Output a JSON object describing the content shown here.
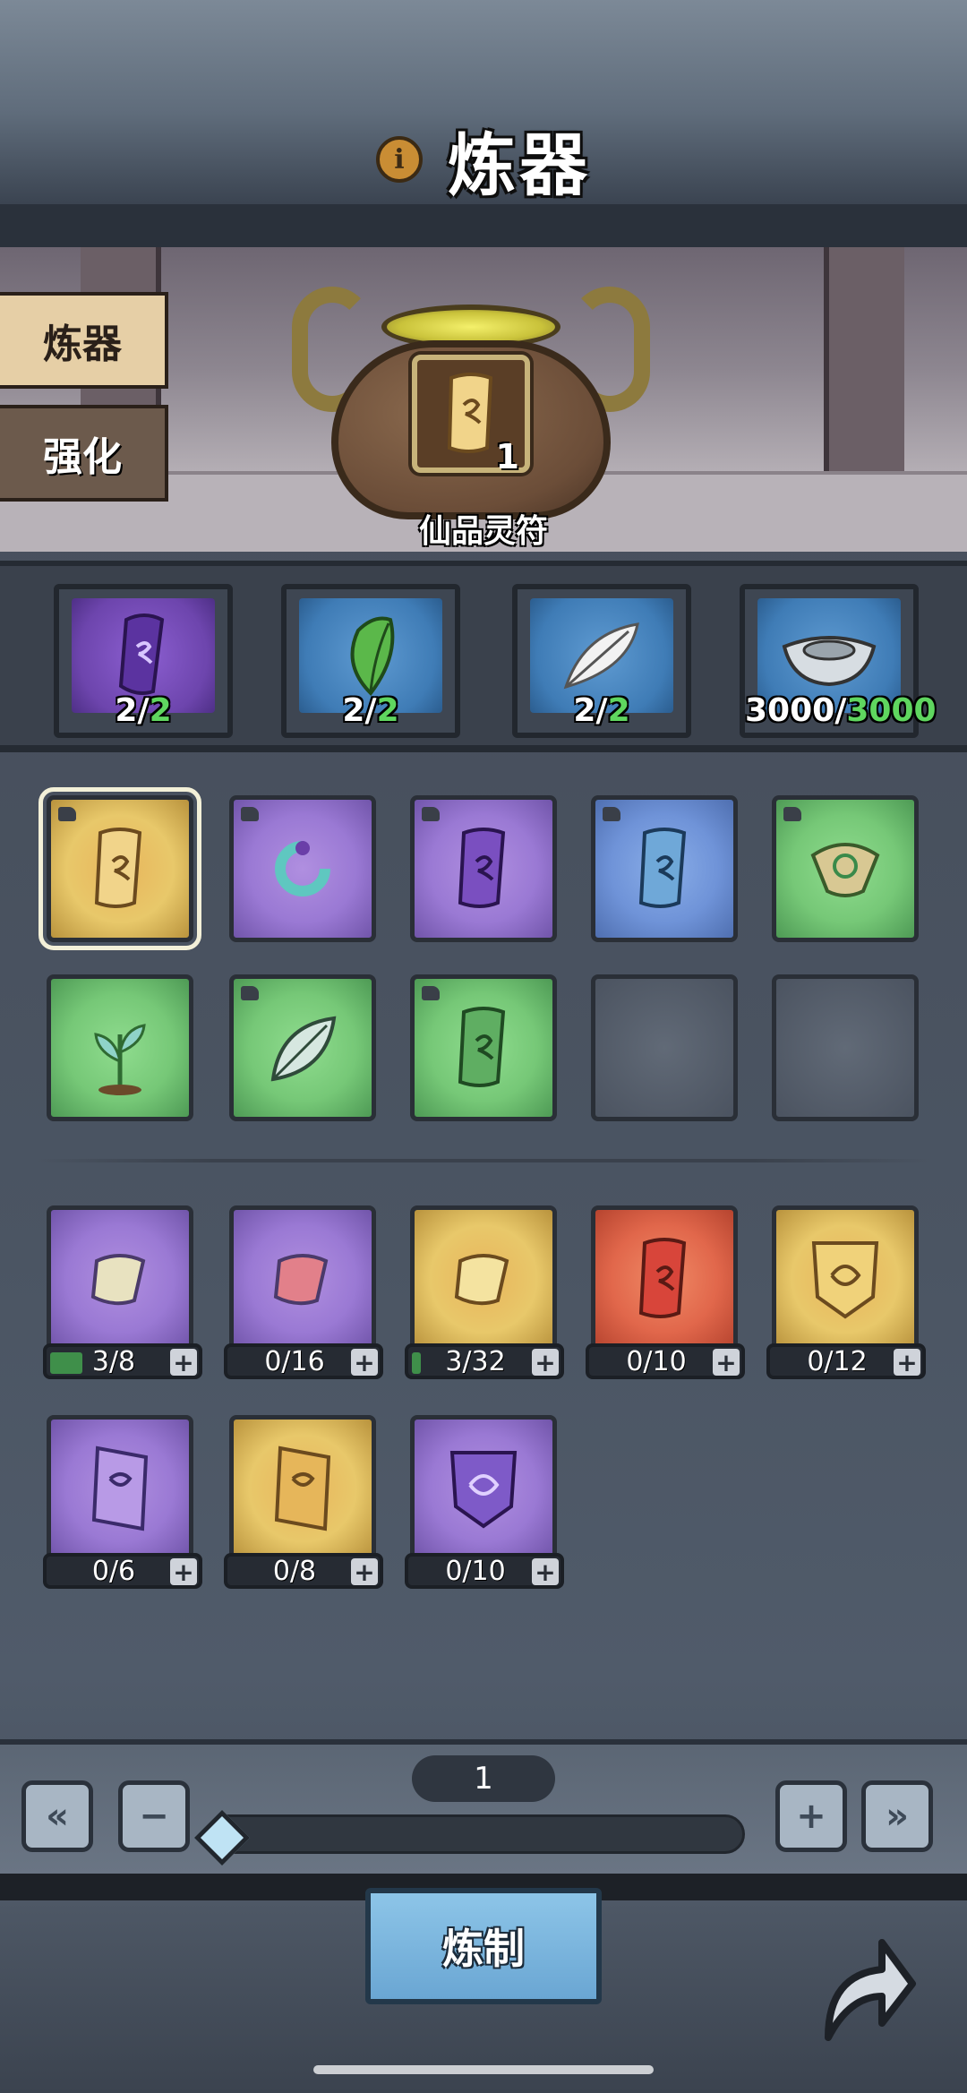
{
  "header": {
    "title": "炼器",
    "info_icon": "info-icon"
  },
  "tabs": [
    {
      "label": "炼器",
      "active": true
    },
    {
      "label": "强化",
      "active": false
    }
  ],
  "furnace": {
    "item_name": "仙品灵符",
    "item_count": "1",
    "item_icon": "scroll-icon"
  },
  "materials": [
    {
      "icon": "purple-scroll-icon",
      "need": "2",
      "have": "2",
      "color": "purple"
    },
    {
      "icon": "leaf-icon",
      "need": "2",
      "have": "2",
      "color": "blue"
    },
    {
      "icon": "feather-icon",
      "need": "2",
      "have": "2",
      "color": "blue"
    },
    {
      "icon": "silver-ingot-icon",
      "need": "3000",
      "have": "3000",
      "color": "blue"
    }
  ],
  "recipes": [
    {
      "icon": "scroll-icon",
      "color": "yellow",
      "selected": true
    },
    {
      "icon": "ring-icon",
      "color": "purple"
    },
    {
      "icon": "scroll-icon",
      "color": "purple"
    },
    {
      "icon": "scroll-icon",
      "color": "blue"
    },
    {
      "icon": "talisman-icon",
      "color": "green"
    },
    {
      "icon": "plant-icon",
      "color": "green"
    },
    {
      "icon": "leaf-icon",
      "color": "green"
    },
    {
      "icon": "scroll-icon",
      "color": "green"
    },
    {
      "icon": "",
      "color": "empty"
    },
    {
      "icon": "",
      "color": "empty"
    }
  ],
  "inventory": [
    {
      "icon": "scroll-icon",
      "color": "purple",
      "label": "3/8",
      "progress": 0.375
    },
    {
      "icon": "scroll-icon",
      "color": "purple",
      "label": "0/16",
      "progress": 0
    },
    {
      "icon": "scroll-icon",
      "color": "yellow",
      "label": "3/32",
      "progress": 0.094
    },
    {
      "icon": "scroll-icon",
      "color": "red",
      "label": "0/10",
      "progress": 0
    },
    {
      "icon": "shield-icon",
      "color": "yellow",
      "label": "0/12",
      "progress": 0
    },
    {
      "icon": "charm-icon",
      "color": "purple",
      "label": "0/6",
      "progress": 0
    },
    {
      "icon": "charm-icon",
      "color": "yellow",
      "label": "0/8",
      "progress": 0
    },
    {
      "icon": "shield-icon",
      "color": "purple",
      "label": "0/10",
      "progress": 0
    }
  ],
  "controls": {
    "quantity": "1",
    "min_label": "«",
    "minus_label": "−",
    "plus_label": "+",
    "max_label": "»",
    "slider_level": 0
  },
  "craft_button": "炼制",
  "share_icon": "arrow-share-icon",
  "colors": {
    "have_count": "#5fd65f",
    "craft_button": "#7ab6df",
    "selected_outline": "#f3f0d8"
  }
}
